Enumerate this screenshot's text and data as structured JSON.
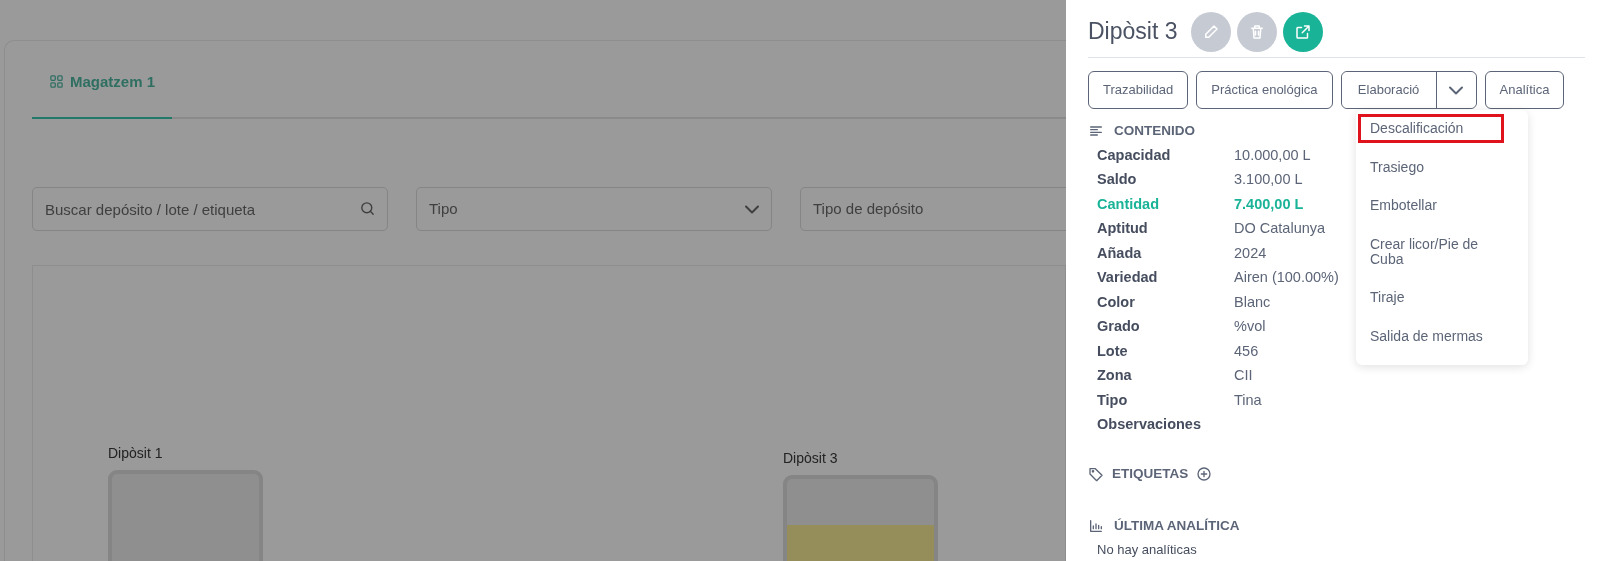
{
  "background": {
    "tabs": [
      {
        "label": "Magatzem 1",
        "selected": true
      }
    ],
    "search": {
      "placeholder": "Buscar depósito / lote / etiqueta"
    },
    "filters": [
      {
        "placeholder": "Tipo"
      },
      {
        "placeholder": "Tipo de depósito"
      }
    ],
    "tanks": [
      {
        "name": "Dipòsit 1",
        "level": 0
      },
      {
        "name": "Dipòsit 3",
        "level": 0.7
      }
    ]
  },
  "panel": {
    "title": "Dipòsit 3",
    "actions": [
      {
        "kind": "edit",
        "disabled": true
      },
      {
        "kind": "delete",
        "disabled": true
      },
      {
        "kind": "open",
        "disabled": false
      }
    ],
    "buttons": [
      {
        "label": "Trazabilidad",
        "kind": "plain"
      },
      {
        "label": "Práctica enológica",
        "kind": "plain"
      },
      {
        "label": "Elaboració",
        "kind": "split",
        "expanded": true
      },
      {
        "label": "Analítica",
        "kind": "plain"
      }
    ],
    "menu": [
      {
        "label": "Descalificación",
        "selected": true
      },
      {
        "label": "Trasiego",
        "selected": false
      },
      {
        "label": "Embotellar",
        "selected": false
      },
      {
        "label": "Crear licor/Pie de Cuba",
        "selected": false
      },
      {
        "label": "Tiraje",
        "selected": false
      },
      {
        "label": "Salida de mermas",
        "selected": false
      }
    ],
    "contenido": {
      "title": "CONTENIDO",
      "rows": [
        {
          "label": "Capacidad",
          "value": "10.000,00 L",
          "highlighted": false
        },
        {
          "label": "Saldo",
          "value": "3.100,00 L",
          "highlighted": false
        },
        {
          "label": "Cantidad",
          "value": "7.400,00 L",
          "highlighted": true
        },
        {
          "label": "Aptitud",
          "value": "DO Catalunya",
          "highlighted": false
        },
        {
          "label": "Añada",
          "value": "2024",
          "highlighted": false
        },
        {
          "label": "Variedad",
          "value": "Airen (100.00%)",
          "highlighted": false
        },
        {
          "label": "Color",
          "value": "Blanc",
          "highlighted": false
        },
        {
          "label": "Grado",
          "value": "%vol",
          "highlighted": false
        },
        {
          "label": "Lote",
          "value": "456",
          "highlighted": false
        },
        {
          "label": "Zona",
          "value": "CII",
          "highlighted": false
        },
        {
          "label": "Tipo",
          "value": "Tina",
          "highlighted": false
        },
        {
          "label": "Observaciones",
          "highlighted": false
        }
      ]
    },
    "etiquetas": {
      "title": "ETIQUETAS"
    },
    "analitica": {
      "title": "ÚLTIMA ANALÍTICA",
      "empty": "No hay analíticas"
    }
  }
}
